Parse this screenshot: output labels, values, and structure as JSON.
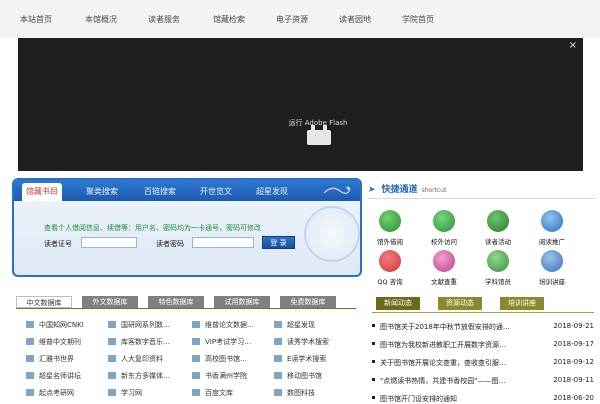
{
  "nav": [
    "本站首页",
    "本馆概况",
    "读者服务",
    "馆藏检索",
    "电子资源",
    "读者园地",
    "学院首页"
  ],
  "flash": {
    "close": "×",
    "run_label": "运行 Adobe Flash"
  },
  "search": {
    "tabs": [
      "馆藏书目",
      "聚类搜索",
      "百链搜索",
      "开世览文",
      "超星发现"
    ],
    "hint": "查看个人借阅信息、续借等：用户名、密码均为一卡通号，密码可修改",
    "card_label": "读者证号",
    "password_label": "读者密码",
    "login_button": "登 录"
  },
  "databases": {
    "tabs": [
      "中文数据库",
      "外文数据库",
      "特色数据库",
      "试用数据库",
      "免费数据库"
    ],
    "items": [
      "中国知网CNKI",
      "国研网系列数…",
      "维普论文数据…",
      "超星发现",
      "维普中文期刊",
      "库客数字音乐…",
      "VIP考试学习…",
      "读秀学术搜索",
      "汇雅书世界",
      "人大复印资料",
      "高校图书馆…",
      "E读学术搜索",
      "超星名师讲坛",
      "新东方多媒体…",
      "书香满州学院",
      "移动图书馆",
      "起点考研网",
      "学习网",
      "百度文库",
      "数图科技"
    ]
  },
  "quick": {
    "title": "快捷通道",
    "subtitle": "shortcut",
    "items": [
      {
        "label": "馆外借阅",
        "color": "#2e8a2e",
        "icon": "books-icon"
      },
      {
        "label": "校外访问",
        "color": "#2c8f3a",
        "icon": "globe-e-icon"
      },
      {
        "label": "读者活动",
        "color": "#2b7a2b",
        "icon": "people-icon"
      },
      {
        "label": "阅读推广",
        "color": "#2a6fc0",
        "icon": "globe-icon"
      },
      {
        "label": "QQ 咨询",
        "color": "#d23232",
        "icon": "qq-icon"
      },
      {
        "label": "文献查重",
        "color": "#c23a8c",
        "icon": "document-icon"
      },
      {
        "label": "学科馆员",
        "color": "#3a8f3a",
        "icon": "person-icon"
      },
      {
        "label": "培训讲座",
        "color": "#3a6fb8",
        "icon": "lecture-icon"
      }
    ]
  },
  "news": {
    "tabs": [
      "新闻动态",
      "资源动态",
      "培训讲座"
    ],
    "rows": [
      {
        "title": "图书馆关于2018年中秋节放假安排的通…",
        "date": "2018-09-21"
      },
      {
        "title": "图书馆为我校新进教职工开展数字资源…",
        "date": "2018-09-17"
      },
      {
        "title": "关于图书馆开展论文查重，查收查引服…",
        "date": "2018-09-12"
      },
      {
        "title": "\"点燃读书热情，共建书香校园\"——图…",
        "date": "2018-09-11"
      },
      {
        "title": "图书馆开门设安排的通知",
        "date": "2018-06-20"
      }
    ]
  }
}
